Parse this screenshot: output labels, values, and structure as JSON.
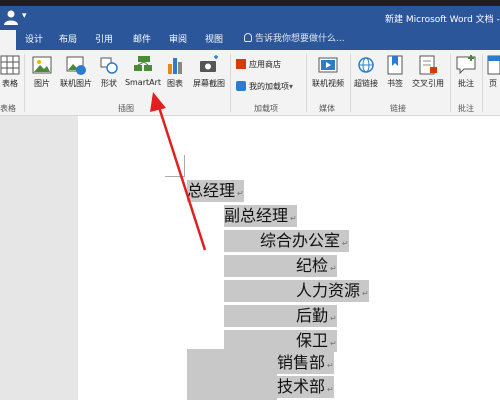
{
  "window": {
    "title": "新建 Microsoft Word 文档 - W",
    "dropdown_glyph": "▾"
  },
  "tabs": [
    {
      "label": ""
    },
    {
      "label": "设计"
    },
    {
      "label": "布局"
    },
    {
      "label": "引用"
    },
    {
      "label": "邮件"
    },
    {
      "label": "审阅"
    },
    {
      "label": "视图"
    }
  ],
  "tell_me": "告诉我你想要做什么...",
  "ribbon": {
    "table_button": "表格",
    "table_group": "表格",
    "illustrations": {
      "picture": "图片",
      "online_picture": "联机图片",
      "shapes": "形状",
      "smartart": "SmartArt",
      "chart": "图表",
      "screenshot": "屏幕截图",
      "group_label": "插图"
    },
    "addins": {
      "store": "应用商店",
      "my_addins": "我的加载项",
      "group_label": "加载项"
    },
    "media": {
      "online_video": "联机视频",
      "group_label": "媒体"
    },
    "links": {
      "hyperlink": "超链接",
      "bookmark": "书签",
      "cross_reference": "交叉引用",
      "group_label": "链接"
    },
    "comments": {
      "comment": "批注",
      "group_label": "批注"
    },
    "header_footer": {
      "header": "页"
    }
  },
  "document": {
    "lines": [
      "总经理",
      "副总经理",
      "综合办公室",
      "纪检",
      "人力资源",
      "后勤",
      "保卫",
      "销售部",
      "技术部"
    ],
    "paragraph_mark": "↵"
  },
  "colors": {
    "title_bar": "#2b579a",
    "ribbon_bg": "#f3f3f3",
    "selection": "#c8c8c8",
    "annotation_arrow": "#e02020"
  }
}
